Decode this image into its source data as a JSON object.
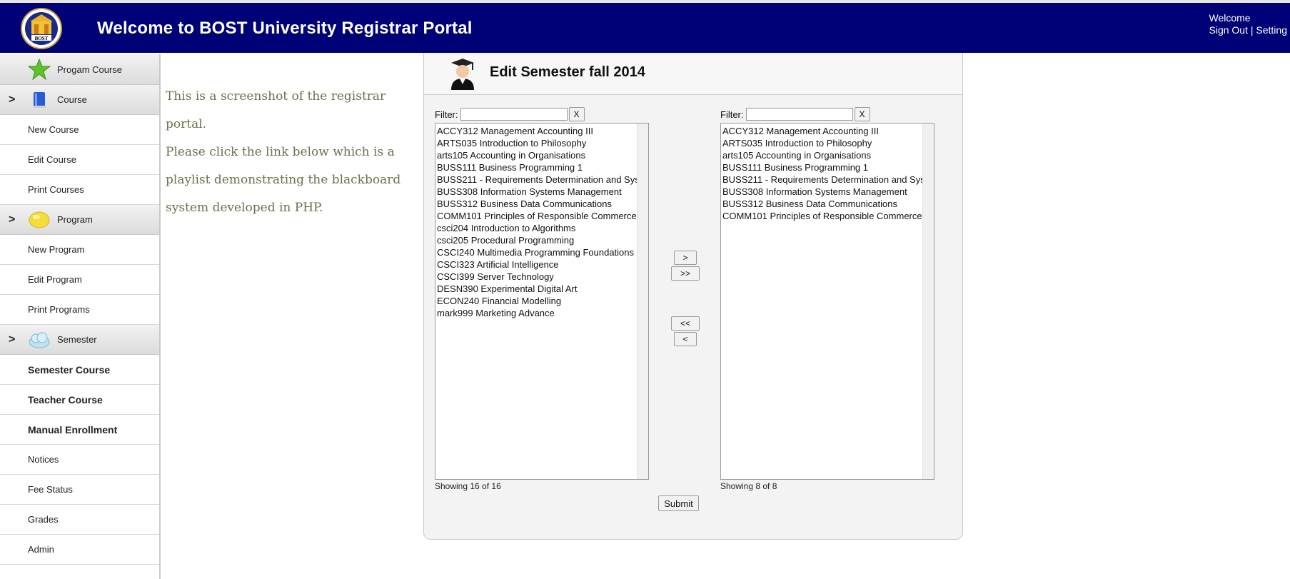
{
  "header": {
    "title": "Welcome to BOST University Registrar Portal",
    "logo_text": "BOST",
    "welcome": "Welcome",
    "sign_out": "Sign Out",
    "separator": "|",
    "setting": "Setting",
    "bg_color": "#000077"
  },
  "sidebar": {
    "program_course": "Progam Course",
    "course_group": "Course",
    "new_course": "New Course",
    "edit_course": "Edit Course",
    "print_courses": "Print Courses",
    "program_group": "Program",
    "new_program": "New Program",
    "edit_program": "Edit Program",
    "print_programs": "Print Programs",
    "semester_group": "Semester",
    "semester_course": "Semester Course",
    "teacher_course": "Teacher Course",
    "manual_enrollment": "Manual Enrollment",
    "notices": "Notices",
    "fee_status": "Fee Status",
    "grades": "Grades",
    "admin": "Admin",
    "chevron": ">"
  },
  "intro": {
    "line1": "This is a screenshot of the registrar portal.",
    "line2": "Please click the link below which is a",
    "line3": "playlist demonstrating the blackboard",
    "line4": "system developed in PHP."
  },
  "panel": {
    "title": "Edit Semester fall 2014",
    "left": {
      "filter_label": "Filter:",
      "filter_value": "",
      "clear_label": "X",
      "items": [
        "ACCY312 Management Accounting III",
        "ARTS035 Introduction to Philosophy",
        "arts105 Accounting in Organisations",
        "BUSS111 Business Programming 1",
        "BUSS211 - Requirements Determination and Sys",
        "BUSS308 Information Systems Management",
        "BUSS312 Business Data Communications",
        "COMM101 Principles of Responsible Commerce",
        "csci204 Introduction to Algorithms",
        "csci205 Procedural Programming",
        "CSCI240 Multimedia Programming Foundations",
        "CSCI323 Artificial Intelligence",
        "CSCI399 Server Technology",
        "DESN390 Experimental Digital Art",
        "ECON240 Financial Modelling",
        "mark999 Marketing Advance"
      ],
      "count_text": "Showing 16 of 16"
    },
    "right": {
      "filter_label": "Filter:",
      "filter_value": "",
      "clear_label": "X",
      "items": [
        "ACCY312 Management Accounting III",
        "ARTS035 Introduction to Philosophy",
        "arts105 Accounting in Organisations",
        "BUSS111 Business Programming 1",
        "BUSS211 - Requirements Determination and Sys",
        "BUSS308 Information Systems Management",
        "BUSS312 Business Data Communications",
        "COMM101 Principles of Responsible Commerce"
      ],
      "count_text": "Showing 8 of 8"
    },
    "buttons": {
      "move_one_right": ">",
      "move_all_right": ">>",
      "move_all_left": "<<",
      "move_one_left": "<",
      "submit": "Submit"
    }
  }
}
